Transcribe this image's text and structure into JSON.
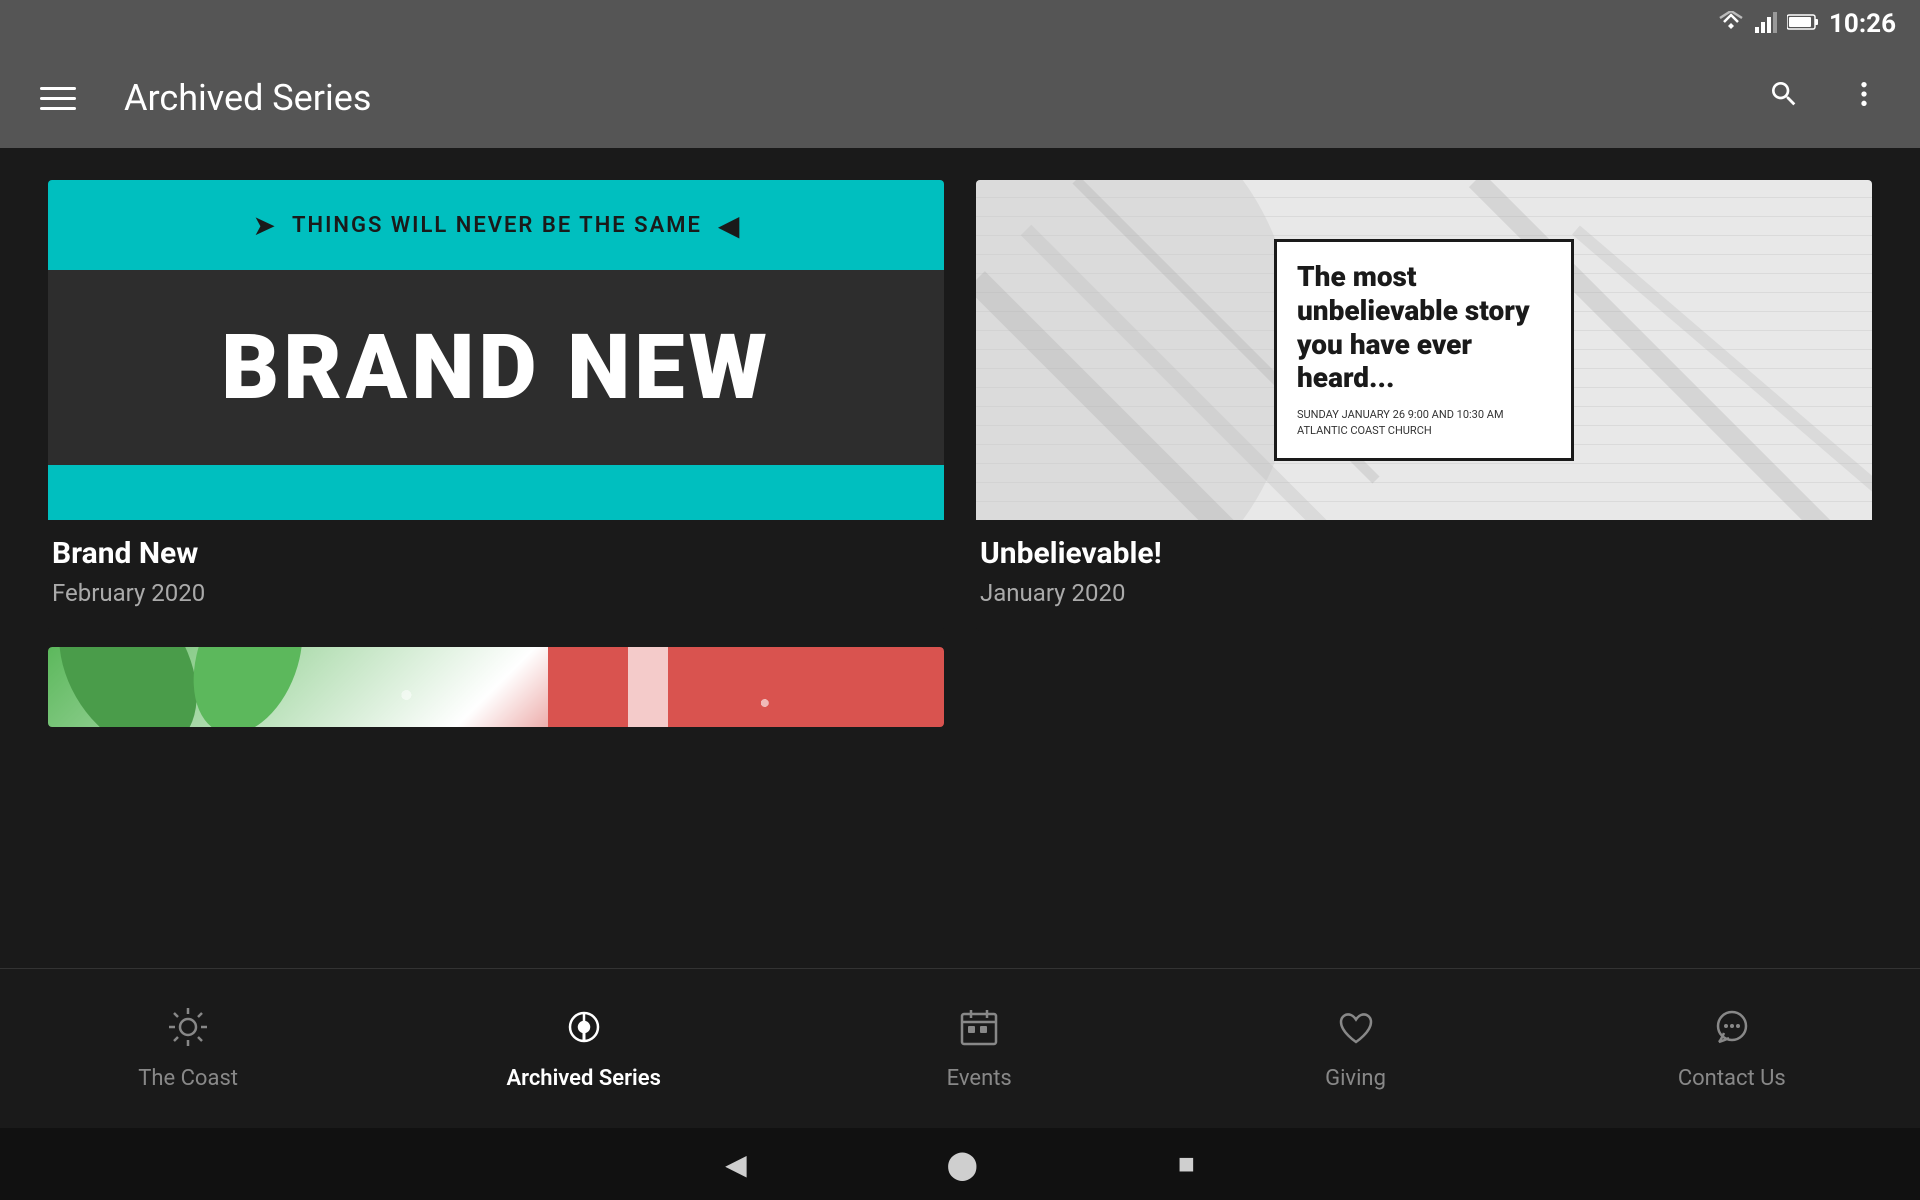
{
  "statusBar": {
    "time": "10:26",
    "wifiIcon": "wifi",
    "signalIcon": "signal",
    "batteryIcon": "battery"
  },
  "appBar": {
    "menuIcon": "☰",
    "title": "Archived Series",
    "searchIcon": "search",
    "moreIcon": "more-vertical"
  },
  "cards": [
    {
      "id": "brand-new",
      "tagline": "THINGS WILL NEVER BE THE SAME",
      "mainText": "BRAND NEW",
      "title": "Brand New",
      "date": "February 2020"
    },
    {
      "id": "unbelievable",
      "boxText": "The most unbelievable story you have ever heard...",
      "subText": "SUNDAY JANUARY 26\n9:00 AND 10:30 AM     ATLANTIC COAST CHURCH",
      "title": "Unbelievable!",
      "date": "January 2020"
    }
  ],
  "bottomNav": {
    "items": [
      {
        "id": "the-coast",
        "label": "The Coast",
        "icon": "☀",
        "active": false
      },
      {
        "id": "archived-series",
        "label": "Archived Series",
        "icon": "🎙",
        "active": true
      },
      {
        "id": "events",
        "label": "Events",
        "icon": "📅",
        "active": false
      },
      {
        "id": "giving",
        "label": "Giving",
        "icon": "♡",
        "active": false
      },
      {
        "id": "contact-us",
        "label": "Contact Us",
        "icon": "💬",
        "active": false
      }
    ]
  },
  "systemNav": {
    "backIcon": "◀",
    "homeIcon": "⬤",
    "squareIcon": "■"
  }
}
